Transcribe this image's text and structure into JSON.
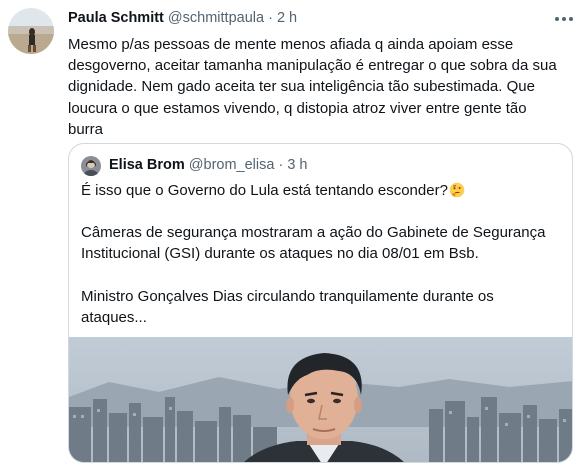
{
  "tweet": {
    "author_name": "Paula Schmitt",
    "handle": "@schmittpaula",
    "separator": "·",
    "time": "2 h",
    "text_lines": [
      "Mesmo p/as pessoas de mente menos afiada q ainda apoiam esse",
      "desgoverno, aceitar tamanha manipulação é entregar o que sobra da sua",
      "dignidade. Nem gado aceita ter sua inteligência tão subestimada. Que",
      "loucura o que estamos vivendo, q distopia atroz viver entre gente tão",
      "burra"
    ],
    "more_icon": "more-horizontal-icon"
  },
  "quote": {
    "author_name": "Elisa Brom",
    "handle": "@brom_elisa",
    "separator": "·",
    "time": "3 h",
    "line1": "É isso que o Governo do Lula está tentando esconder?",
    "line1_emoji": "thinking-face-emoji",
    "para2_lines": [
      "Câmeras de segurança mostraram a ação do Gabinete de Segurança",
      "Institucional (GSI) durante os ataques no dia 08/01 em Bsb."
    ],
    "para3_lines": [
      "Ministro Gonçalves Dias circulando tranquilamente durante os",
      "ataques..."
    ]
  }
}
